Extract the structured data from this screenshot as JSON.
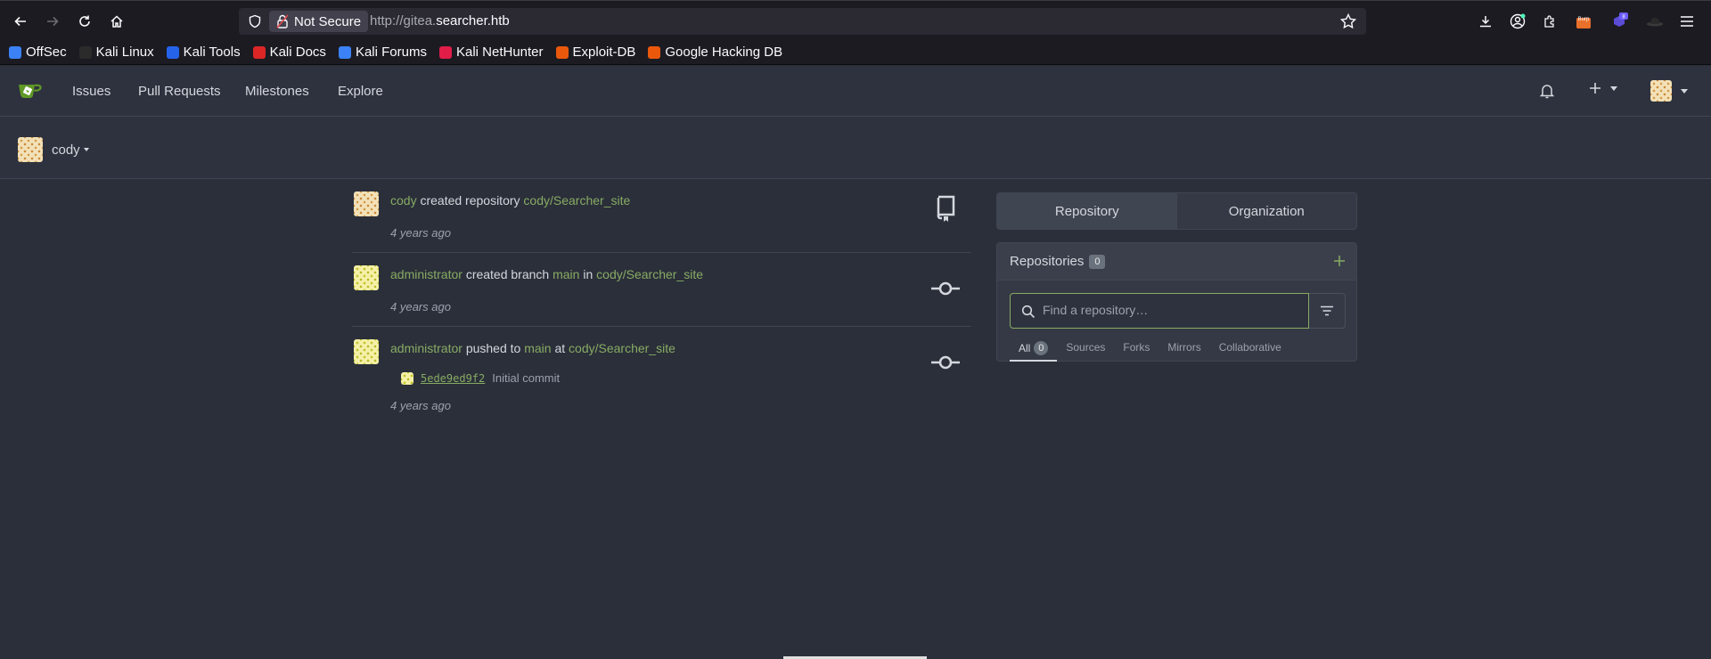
{
  "browser": {
    "url_security": "Not Secure",
    "url_prefix": "http://gitea.",
    "url_domain": "searcher.htb",
    "extension_badge": "8",
    "burp_label": "Burp",
    "bookmarks": [
      {
        "label": "OffSec",
        "icon": "offsec-icon",
        "color": "#3b82f6"
      },
      {
        "label": "Kali Linux",
        "icon": "kali-dragon-icon",
        "color": "#2b2b2b"
      },
      {
        "label": "Kali Tools",
        "icon": "kali-tools-icon",
        "color": "#2563eb"
      },
      {
        "label": "Kali Docs",
        "icon": "kali-docs-icon",
        "color": "#dc2626"
      },
      {
        "label": "Kali Forums",
        "icon": "kali-forums-icon",
        "color": "#3b82f6"
      },
      {
        "label": "Kali NetHunter",
        "icon": "nethunter-icon",
        "color": "#e11d48"
      },
      {
        "label": "Exploit-DB",
        "icon": "exploitdb-icon",
        "color": "#ea580c"
      },
      {
        "label": "Google Hacking DB",
        "icon": "ghdb-icon",
        "color": "#ea580c"
      }
    ]
  },
  "header": {
    "nav": [
      "Issues",
      "Pull Requests",
      "Milestones",
      "Explore"
    ]
  },
  "context": {
    "user": "cody"
  },
  "feed": [
    {
      "actor": "cody",
      "action": "created repository",
      "target": "cody/Searcher_site",
      "time": "4 years ago",
      "icon": "repo-icon"
    },
    {
      "actor": "administrator",
      "action": "created branch",
      "branch": "main",
      "prep": "in",
      "target": "cody/Searcher_site",
      "time": "4 years ago",
      "icon": "git-commit-icon"
    },
    {
      "actor": "administrator",
      "action": "pushed to",
      "branch": "main",
      "prep": "at",
      "target": "cody/Searcher_site",
      "commit_sha": "5ede9ed9f2",
      "commit_msg": "Initial commit",
      "time": "4 years ago",
      "icon": "git-commit-icon"
    }
  ],
  "panel": {
    "tabs": [
      "Repository",
      "Organization"
    ],
    "repos_title": "Repositories",
    "repos_count": "0",
    "search_placeholder": "Find a repository…",
    "filter_tabs": [
      "All",
      "Sources",
      "Forks",
      "Mirrors",
      "Collaborative"
    ],
    "all_count": "0"
  },
  "colors": {
    "link": "#87ab63",
    "background": "#2b2f3a",
    "header": "#2e323e"
  }
}
